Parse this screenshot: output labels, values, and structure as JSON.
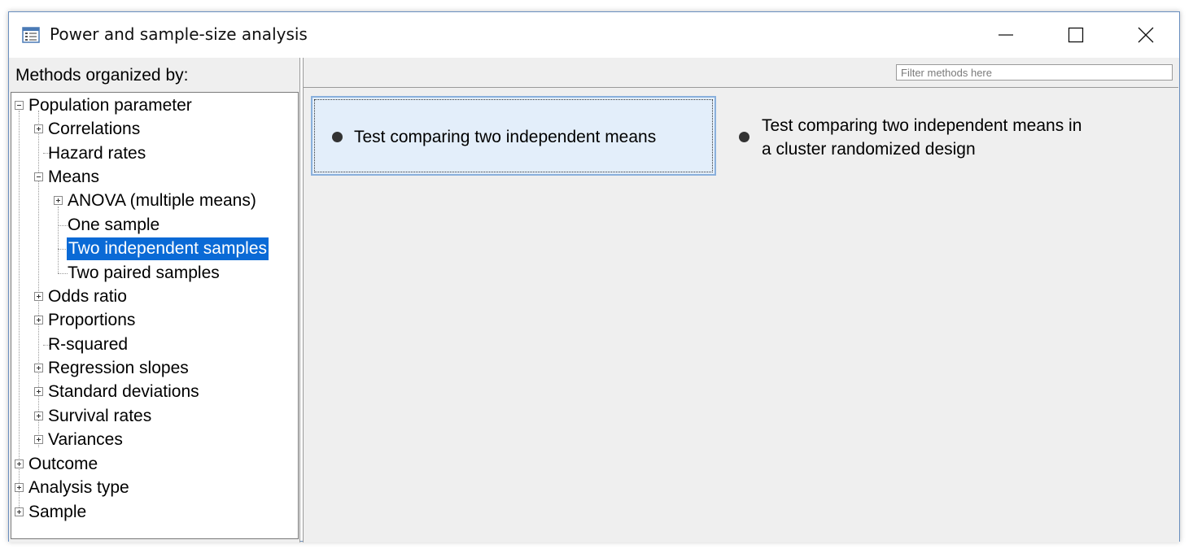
{
  "window": {
    "title": "Power and sample-size analysis",
    "controls": {
      "minimize": "—",
      "maximize": "☐",
      "close": "✕"
    }
  },
  "left": {
    "label": "Methods organized by:",
    "tree": [
      {
        "label": "Population parameter",
        "expanded": true
      },
      {
        "label": "Correlations",
        "expanded": false
      },
      {
        "label": "Hazard rates"
      },
      {
        "label": "Means",
        "expanded": true
      },
      {
        "label": "ANOVA (multiple means)",
        "expanded": false
      },
      {
        "label": "One sample"
      },
      {
        "label": "Two independent samples",
        "selected": true
      },
      {
        "label": "Two paired samples"
      },
      {
        "label": "Odds ratio",
        "expanded": false
      },
      {
        "label": "Proportions",
        "expanded": false
      },
      {
        "label": "R-squared"
      },
      {
        "label": "Regression slopes",
        "expanded": false
      },
      {
        "label": "Standard deviations",
        "expanded": false
      },
      {
        "label": "Survival rates",
        "expanded": false
      },
      {
        "label": "Variances",
        "expanded": false
      },
      {
        "label": "Outcome",
        "expanded": false
      },
      {
        "label": "Analysis type",
        "expanded": false
      },
      {
        "label": "Sample",
        "expanded": false
      }
    ]
  },
  "right": {
    "filter_placeholder": "Filter methods here",
    "methods": [
      {
        "line1": "Test comparing two independent means",
        "line2": "",
        "selected": true
      },
      {
        "line1": "Test comparing two independent means in",
        "line2": "a cluster randomized design",
        "selected": false
      }
    ]
  },
  "colors": {
    "selection": "#0a6ad6",
    "card_fill": "#e3eefa",
    "card_border": "#8ab0dc",
    "pane_bg": "#efefef"
  }
}
